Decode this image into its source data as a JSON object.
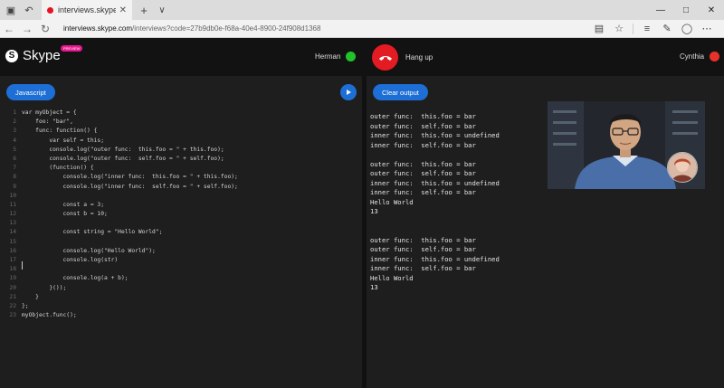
{
  "browser": {
    "tab_title": "interviews.skype.co",
    "url_host": "interviews.skype.com",
    "url_path": "/interviews?code=27b9db0e-f68a-40e4-8900-24f908d1368"
  },
  "header": {
    "brand": "Skype",
    "badge": "PREVIEW",
    "participant_left": "Herman",
    "participant_right": "Cynthia",
    "hangup_label": "Hang up",
    "colors": {
      "online": "#22c32a",
      "offline": "#e6322a",
      "hangup": "#e31b23",
      "accent": "#1d6fd6"
    }
  },
  "editor": {
    "language_button": "Javascript",
    "run_icon": "play-icon",
    "lines": [
      {
        "n": "1",
        "text": "var myObject = {"
      },
      {
        "n": "2",
        "text": "    foo: \"bar\","
      },
      {
        "n": "3",
        "text": "    func: function() {"
      },
      {
        "n": "4",
        "text": "        var self = this;"
      },
      {
        "n": "5",
        "text": "        console.log(\"outer func:  this.foo = \" + this.foo);"
      },
      {
        "n": "6",
        "text": "        console.log(\"outer func:  self.foo = \" + self.foo);"
      },
      {
        "n": "7",
        "text": "        (function() {"
      },
      {
        "n": "8",
        "text": "            console.log(\"inner func:  this.foo = \" + this.foo);"
      },
      {
        "n": "9",
        "text": "            console.log(\"inner func:  self.foo = \" + self.foo);"
      },
      {
        "n": "10",
        "text": ""
      },
      {
        "n": "11",
        "text": "            const a = 3;"
      },
      {
        "n": "12",
        "text": "            const b = 10;"
      },
      {
        "n": "13",
        "text": ""
      },
      {
        "n": "14",
        "text": "            const string = \"Hello World\";"
      },
      {
        "n": "15",
        "text": ""
      },
      {
        "n": "16",
        "text": "            console.log(\"Hello World\");"
      },
      {
        "n": "17",
        "text": "            console.log(str)"
      },
      {
        "n": "18",
        "text": ""
      },
      {
        "n": "19",
        "text": "            console.log(a + b);"
      },
      {
        "n": "20",
        "text": "        }());"
      },
      {
        "n": "21",
        "text": "    }"
      },
      {
        "n": "22",
        "text": "};"
      },
      {
        "n": "23",
        "text": "myObject.func();"
      }
    ]
  },
  "output": {
    "clear_button": "Clear output",
    "lines": [
      "outer func:  this.foo = bar",
      "outer func:  self.foo = bar",
      "inner func:  this.foo = undefined",
      "inner func:  self.foo = bar",
      "",
      "outer func:  this.foo = bar",
      "outer func:  self.foo = bar",
      "inner func:  this.foo = undefined",
      "inner func:  self.foo = bar",
      "Hello World",
      "13",
      "",
      "",
      "outer func:  this.foo = bar",
      "outer func:  self.foo = bar",
      "inner func:  this.foo = undefined",
      "inner func:  self.foo = bar",
      "Hello World",
      "13"
    ]
  }
}
